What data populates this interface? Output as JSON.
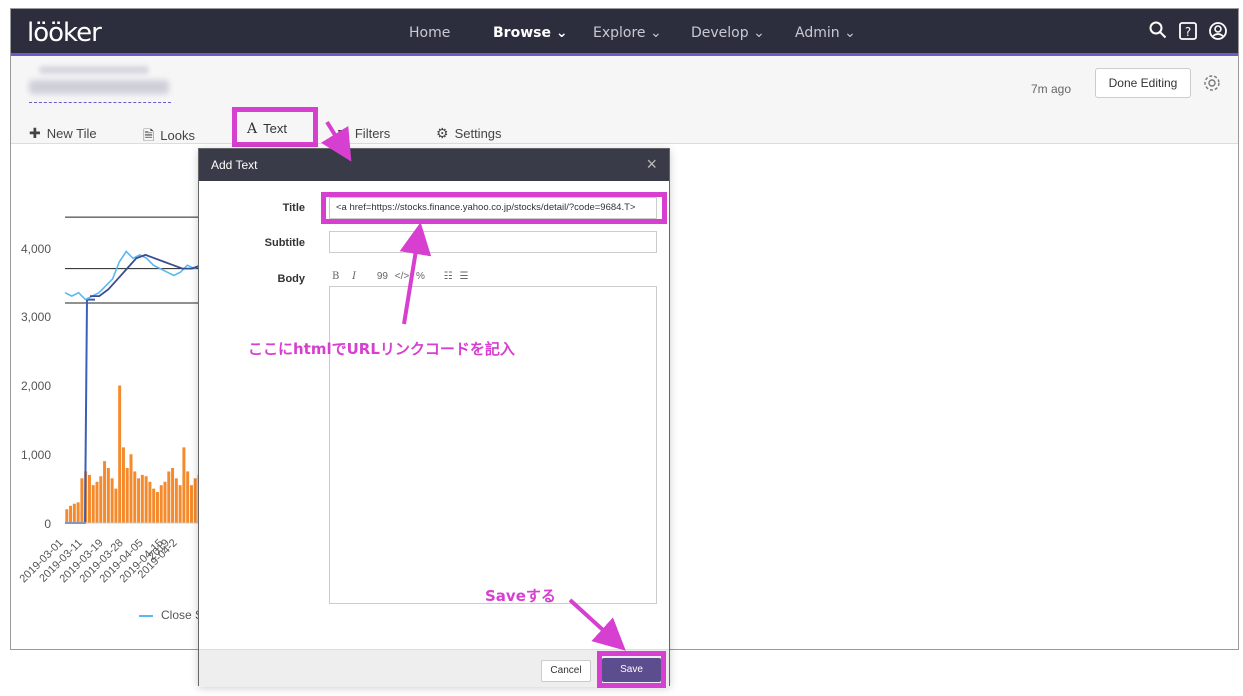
{
  "navbar": {
    "logo": "lööker",
    "items": [
      {
        "label": "Home",
        "active": false
      },
      {
        "label": "Browse ⌄",
        "active": true
      },
      {
        "label": "Explore ⌄",
        "active": false
      },
      {
        "label": "Develop ⌄",
        "active": false
      },
      {
        "label": "Admin ⌄",
        "active": false
      }
    ],
    "icons": [
      "search-icon",
      "help-icon",
      "user-icon"
    ]
  },
  "dashboard": {
    "updated_ago": "7m ago",
    "done_editing": "Done Editing",
    "toolbar": {
      "new_tile": "New Tile",
      "looks": "Looks",
      "text": "Text",
      "filters": "Filters",
      "settings": "Settings"
    }
  },
  "chart_data": {
    "type": "bar",
    "yticks": [
      "4,000",
      "3,000",
      "2,000",
      "1,000",
      "0"
    ],
    "ylim": [
      0,
      4500
    ],
    "xticks": [
      "2019-03-01",
      "2019-03-11",
      "2019-03-19",
      "2019-03-28",
      "2019-04-05",
      "2019-04-15",
      "2019-04-2",
      "2019"
    ],
    "legend": "Close S",
    "volume_values": [
      200,
      250,
      280,
      300,
      650,
      750,
      700,
      550,
      600,
      680,
      900,
      800,
      650,
      500,
      2000,
      1100,
      800,
      1000,
      750,
      650,
      700,
      680,
      600,
      500,
      450,
      550,
      600,
      750,
      800,
      650,
      550,
      1100,
      750,
      550,
      650,
      700
    ],
    "close_line": [
      3350,
      3300,
      3350,
      3250,
      3300,
      3350,
      3450,
      3550,
      3800,
      3950,
      3850,
      3900,
      3850,
      3750,
      3700,
      3650,
      3600,
      3650,
      3750,
      3700,
      3750
    ],
    "ma_line": [
      3300,
      3300,
      3400,
      3550,
      3700,
      3850,
      3900,
      3850,
      3800,
      3750,
      3700,
      3700,
      3750
    ],
    "step_line_y": 3250,
    "ref_lines": [
      4450,
      3700,
      3200
    ]
  },
  "modal": {
    "title": "Add Text",
    "close": "×",
    "labels": {
      "title": "Title",
      "subtitle": "Subtitle",
      "body": "Body"
    },
    "title_value": "<a href=https://stocks.finance.yahoo.co.jp/stocks/detail/?code=9684.T>",
    "subtitle_value": "",
    "editor_toolbar": [
      "B",
      "I",
      "99",
      "</>",
      "%",
      "☷",
      "☰"
    ],
    "cancel": "Cancel",
    "save": "Save"
  },
  "annotations": {
    "html_note": "ここにhtmlでURLリンクコードを記入",
    "save_note": "Saveする"
  },
  "colors": {
    "navbar": "#2d2e3d",
    "accent": "#6b5bc9",
    "highlight": "#d63fcf",
    "bar": "#f58a2c",
    "line_light": "#5ab8f0",
    "line_dark": "#3b5fb8",
    "save_button": "#5c4d8f"
  }
}
